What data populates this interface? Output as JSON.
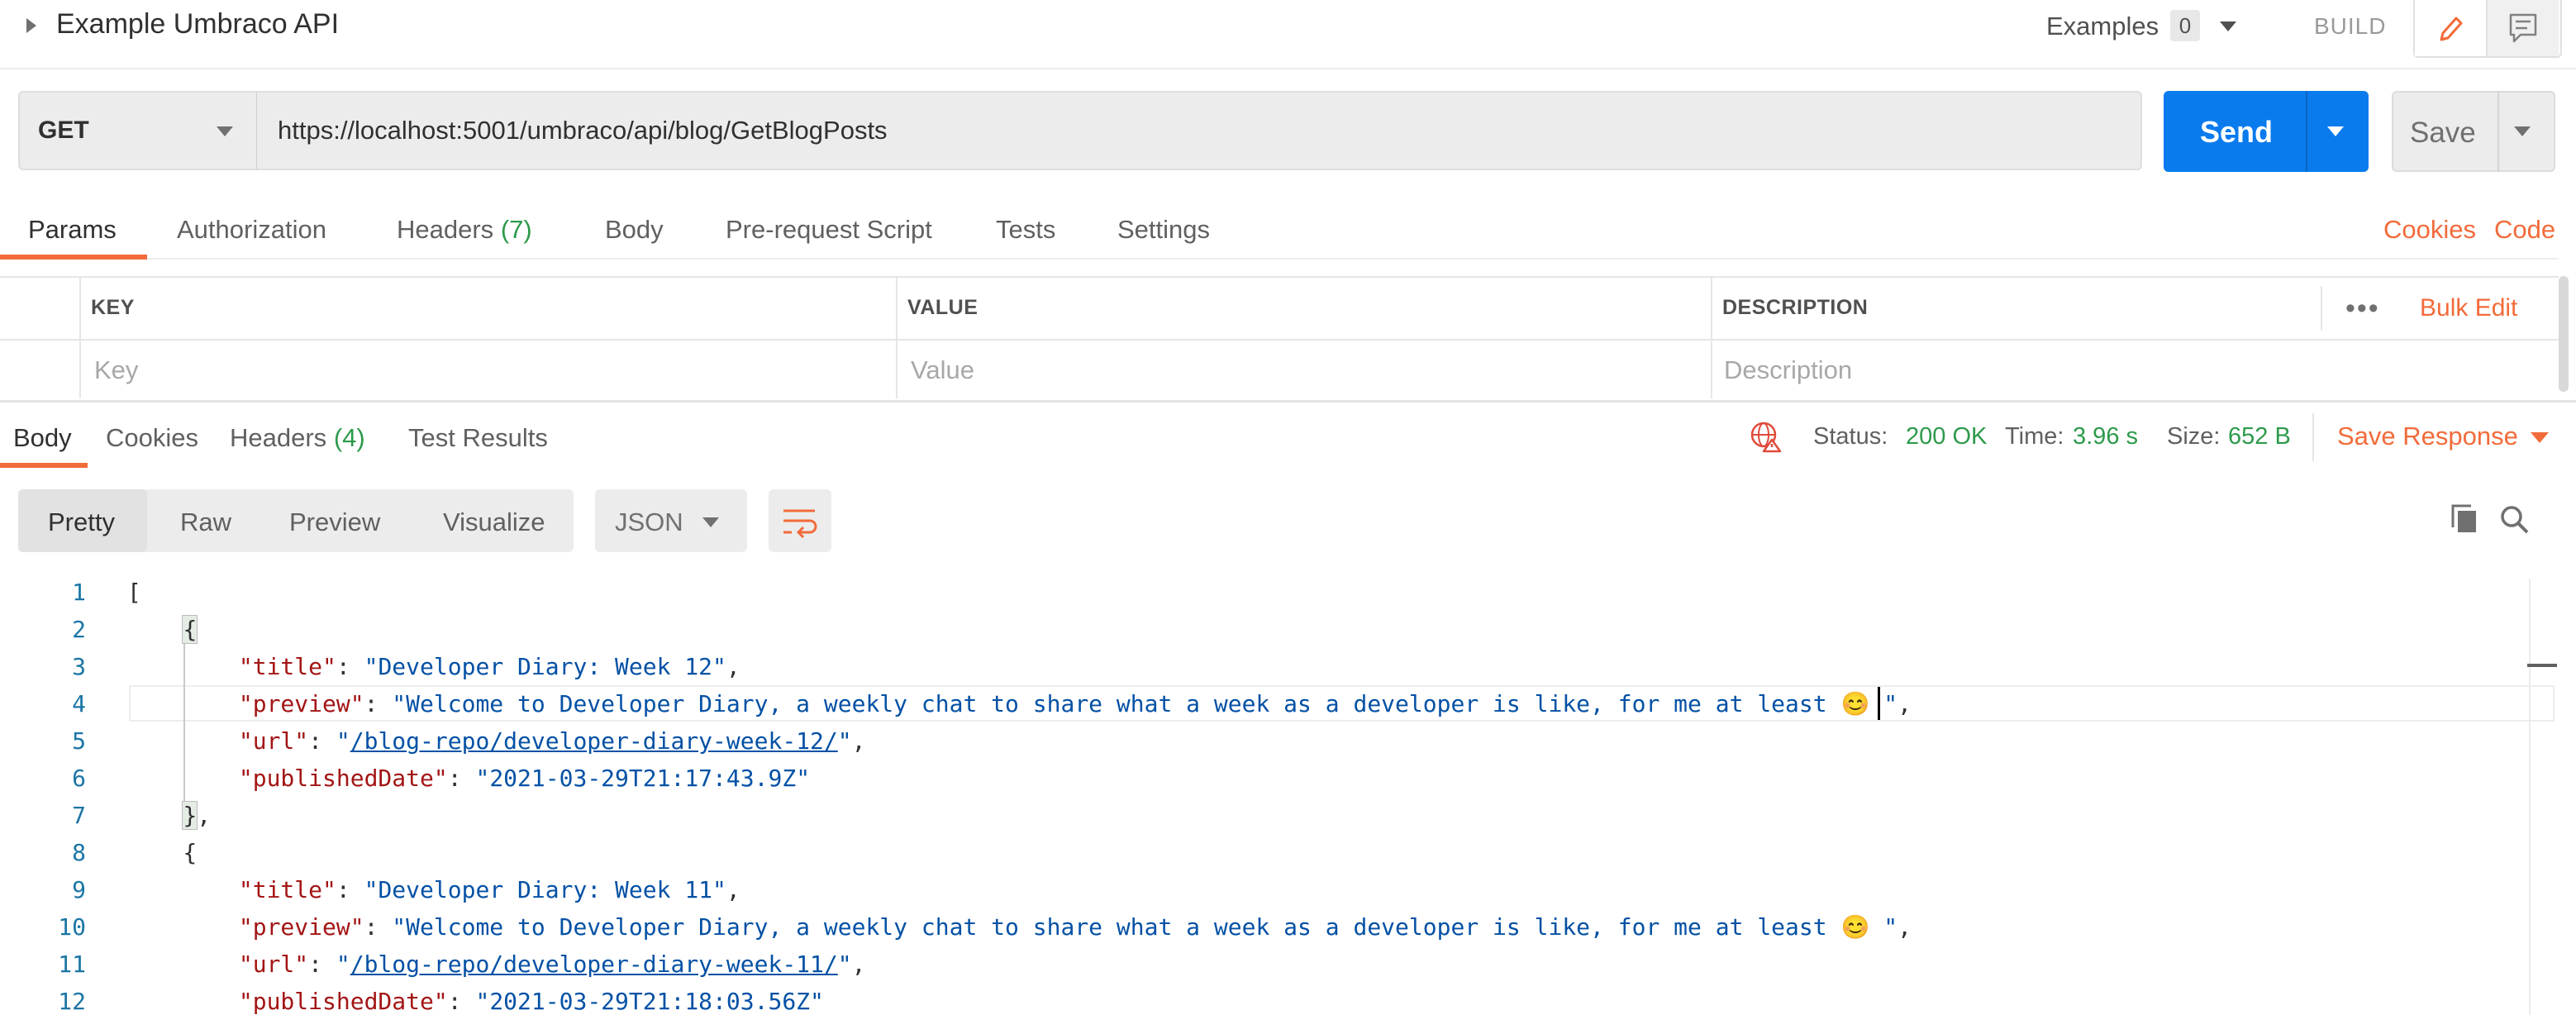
{
  "header": {
    "title": "Example Umbraco API",
    "examples_label": "Examples",
    "examples_count": "0",
    "build_label": "BUILD"
  },
  "request": {
    "method": "GET",
    "url": "https://localhost:5001/umbraco/api/blog/GetBlogPosts",
    "send_label": "Send",
    "save_label": "Save"
  },
  "request_tabs": {
    "params": "Params",
    "authorization": "Authorization",
    "headers": "Headers",
    "headers_count": "(7)",
    "body": "Body",
    "prerequest": "Pre-request Script",
    "tests": "Tests",
    "settings": "Settings",
    "cookies": "Cookies",
    "code": "Code"
  },
  "params_table": {
    "col_key": "KEY",
    "col_value": "VALUE",
    "col_description": "DESCRIPTION",
    "bulk_edit": "Bulk Edit",
    "key_placeholder": "Key",
    "value_placeholder": "Value",
    "description_placeholder": "Description"
  },
  "response_tabs": {
    "body": "Body",
    "cookies": "Cookies",
    "headers": "Headers",
    "headers_count": "(4)",
    "test_results": "Test Results"
  },
  "response_meta": {
    "status_label": "Status:",
    "status_value": "200 OK",
    "time_label": "Time:",
    "time_value": "3.96 s",
    "size_label": "Size:",
    "size_value": "652 B",
    "save_response": "Save Response"
  },
  "view_modes": {
    "pretty": "Pretty",
    "raw": "Raw",
    "preview": "Preview",
    "visualize": "Visualize",
    "format": "JSON"
  },
  "code": {
    "line_numbers": [
      "1",
      "2",
      "3",
      "4",
      "5",
      "6",
      "7",
      "8",
      "9",
      "10",
      "11",
      "12"
    ],
    "posts": [
      {
        "title": "Developer Diary: Week 12",
        "preview": "Welcome to Developer Diary, a weekly chat to share what a week as a developer is like, for me at least 😊 ",
        "url": "/blog-repo/developer-diary-week-12/",
        "publishedDate": "2021-03-29T21:17:43.9Z"
      },
      {
        "title": "Developer Diary: Week 11",
        "preview": "Welcome to Developer Diary, a weekly chat to share what a week as a developer is like, for me at least 😊 ",
        "url": "/blog-repo/developer-diary-week-11/",
        "publishedDate": "2021-03-29T21:18:03.56Z"
      }
    ]
  },
  "icons": {
    "edit": "pencil-icon",
    "comments": "comment-icon",
    "wrap": "wrap-lines-icon",
    "copy": "copy-icon",
    "search": "search-icon",
    "ssl_warning": "globe-warning-icon"
  },
  "colors": {
    "accent_orange": "#f26b3a",
    "send_blue": "#097bed",
    "status_green": "#2d9a4b",
    "json_key": "#a31515",
    "json_string": "#0451a5"
  }
}
